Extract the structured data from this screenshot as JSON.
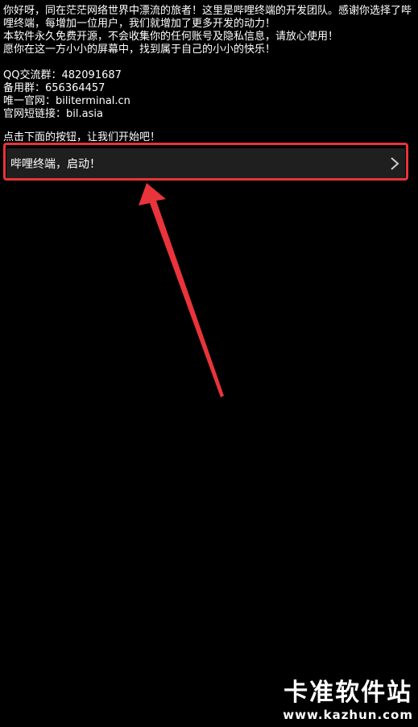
{
  "intro": {
    "line1": "你好呀，同在茫茫网络世界中漂流的旅者！这里是哔哩终端的开发团队。感谢你选择了哔哩终端，每增加一位用户，我们就增加了更多开发的动力！",
    "line2": "本软件永久免费开源，不会收集你的任何账号及隐私信息，请放心使用！",
    "line3": "愿你在这一方小小的屏幕中，找到属于自己的小小的快乐！"
  },
  "contacts": {
    "qq_group": "QQ交流群：482091687",
    "backup_group": "备用群：656364457",
    "official_site": "唯一官网：biliterminal.cn",
    "short_link": "官网短链接：bil.asia"
  },
  "prompt": "点击下面的按钮，让我们开始吧！",
  "start_button": {
    "label": "哔哩终端，启动！",
    "icon": "chevron-right-icon"
  },
  "annotation": {
    "color": "#e8343a"
  },
  "watermark": {
    "title": "卡准软件站",
    "url": "www.kazhun.com"
  }
}
